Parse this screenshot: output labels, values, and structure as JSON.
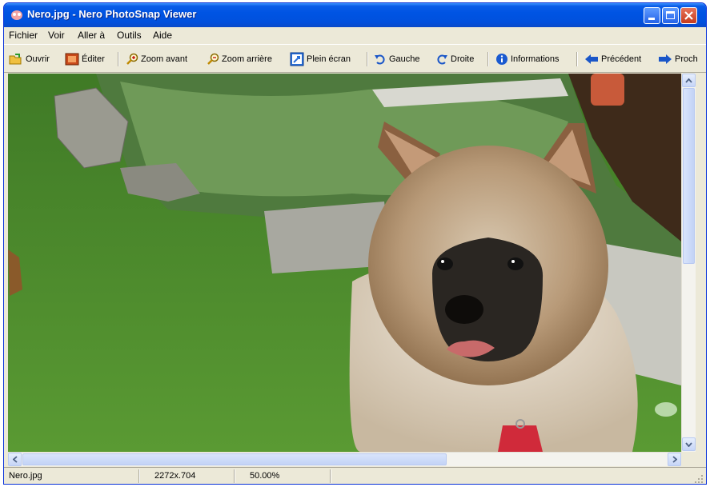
{
  "window": {
    "title": "Nero.jpg - Nero PhotoSnap Viewer"
  },
  "menu": [
    "Fichier",
    "Voir",
    "Aller à",
    "Outils",
    "Aide"
  ],
  "toolbar": {
    "open": "Ouvrir",
    "edit": "Éditer",
    "zoom_in": "Zoom avant",
    "zoom_out": "Zoom arrière",
    "fullscreen": "Plein écran",
    "rotate_left": "Gauche",
    "rotate_right": "Droite",
    "info": "Informations",
    "previous": "Précédent",
    "next": "Proch"
  },
  "status": {
    "filename": "Nero.jpg",
    "dimensions": "2272x.704",
    "zoom": "50.00%"
  },
  "colors": {
    "titlebar": "#0054e3",
    "close": "#c53a1d",
    "chrome": "#ece9d8"
  }
}
